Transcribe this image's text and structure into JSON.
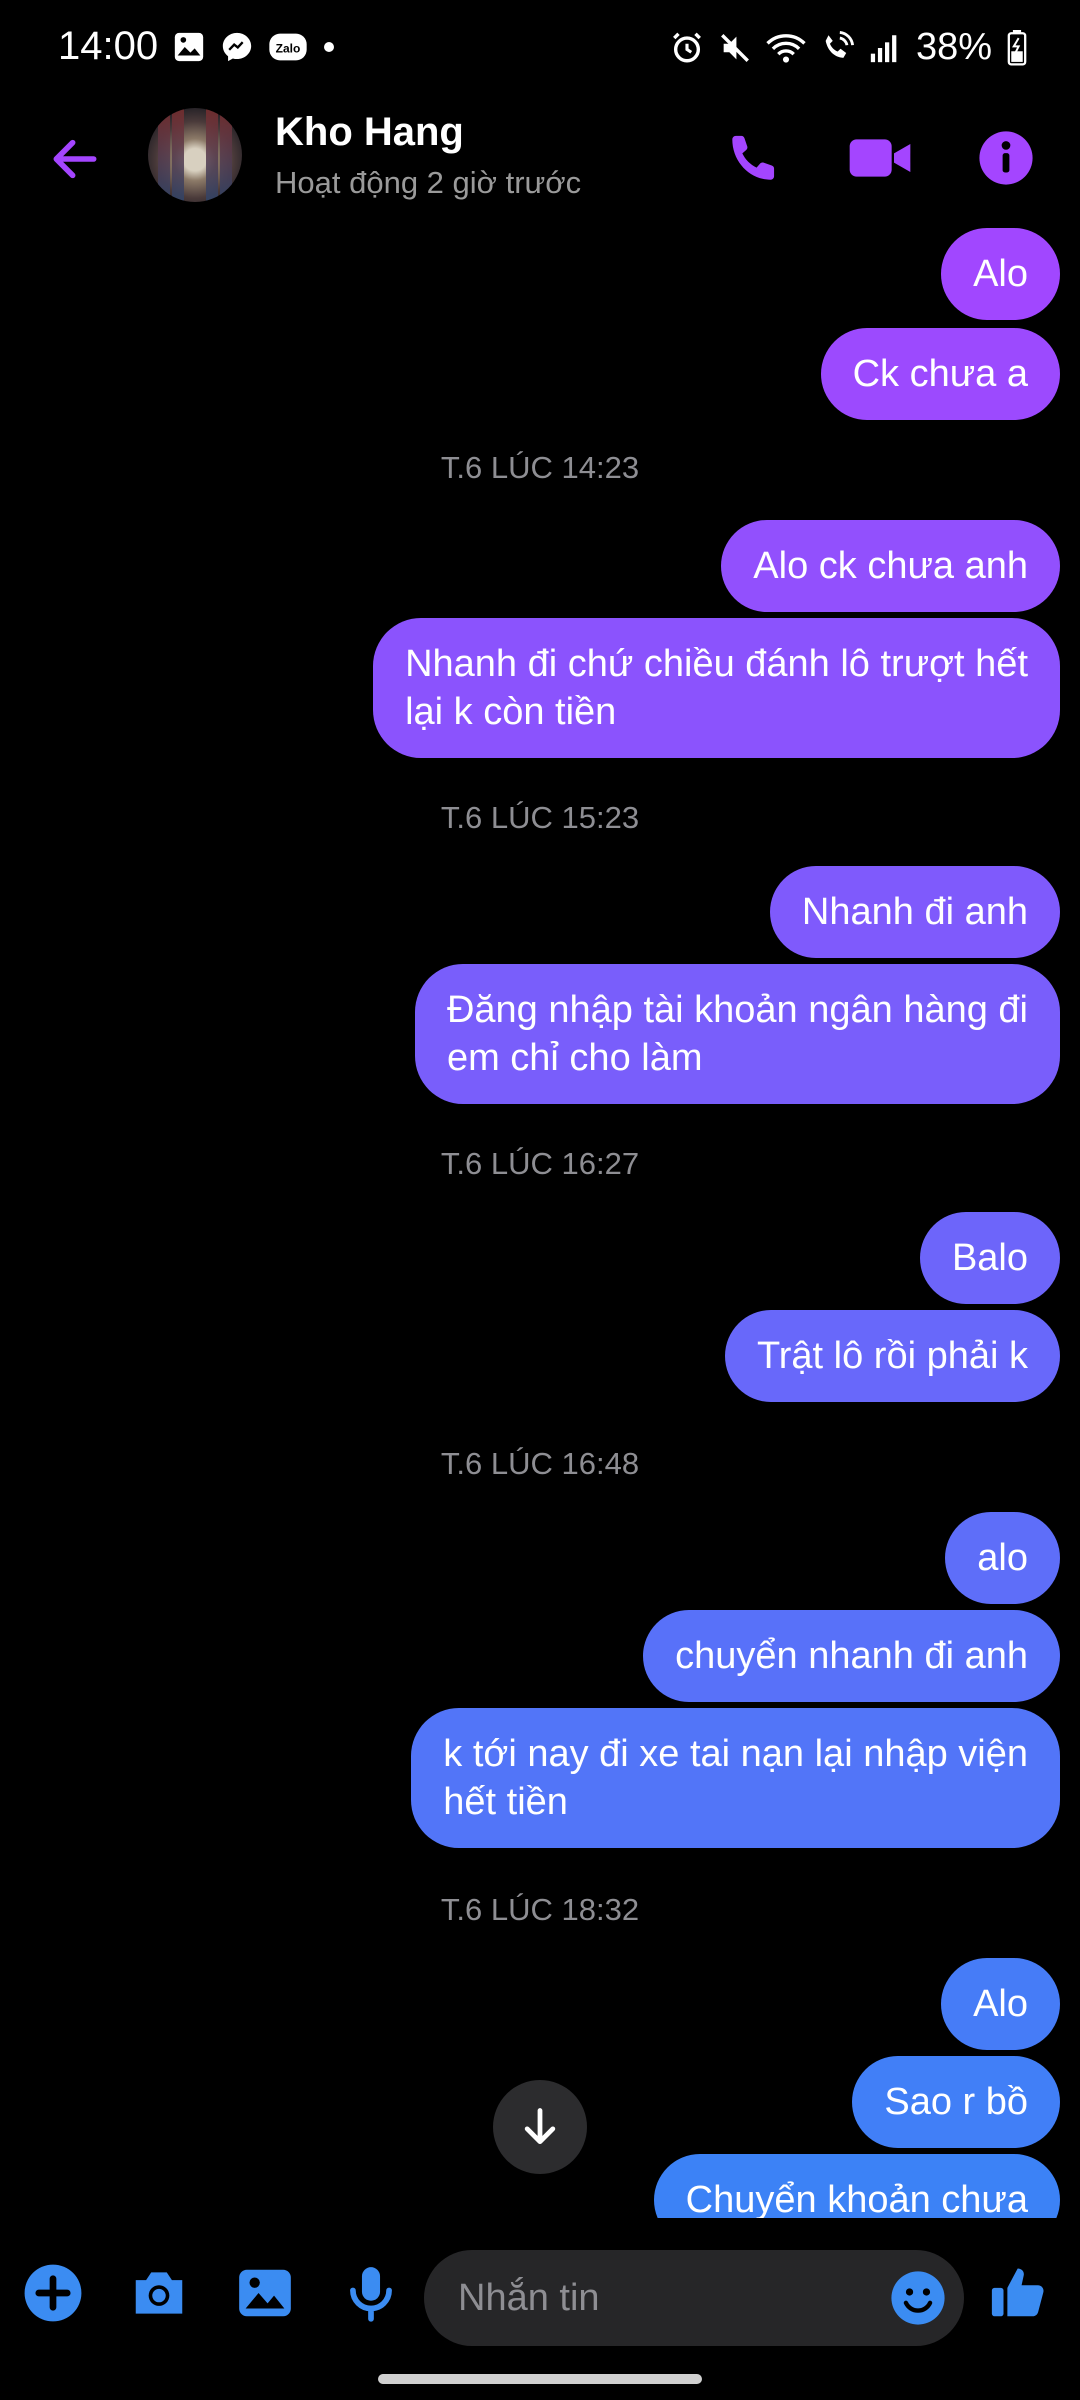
{
  "status_bar": {
    "time": "14:00",
    "battery": "38%",
    "left_icons": [
      "gallery-icon",
      "messenger-icon",
      "zalo-icon",
      "dot-icon"
    ],
    "right_icons": [
      "alarm-icon",
      "mute-icon",
      "wifi-icon",
      "wifi-call-icon",
      "signal-icon",
      "battery-icon"
    ]
  },
  "header": {
    "contact_name": "Kho Hang",
    "contact_status": "Hoạt động 2 giờ trước",
    "accent_color": "#a445ff"
  },
  "messages": [
    {
      "type": "outgoing",
      "text": "Alo"
    },
    {
      "type": "outgoing",
      "text": "Ck chưa a"
    },
    {
      "type": "timestamp",
      "text": "T.6 LÚC 14:23"
    },
    {
      "type": "outgoing",
      "text": "Alo ck chưa anh"
    },
    {
      "type": "outgoing",
      "text": "Nhanh đi chứ chiều đánh lô trượt hết\nlại k còn tiền"
    },
    {
      "type": "timestamp",
      "text": "T.6 LÚC 15:23"
    },
    {
      "type": "outgoing",
      "text": "Nhanh đi anh"
    },
    {
      "type": "outgoing",
      "text": "Đăng nhập tài khoản ngân hàng đi\nem chỉ cho làm"
    },
    {
      "type": "timestamp",
      "text": "T.6 LÚC 16:27"
    },
    {
      "type": "outgoing",
      "text": "Balo"
    },
    {
      "type": "outgoing",
      "text": "Trật lô rồi phải k"
    },
    {
      "type": "timestamp",
      "text": "T.6 LÚC 16:48"
    },
    {
      "type": "outgoing",
      "text": "alo"
    },
    {
      "type": "outgoing",
      "text": "chuyển nhanh đi anh"
    },
    {
      "type": "outgoing",
      "text": "k tới nay đi xe tai nạn lại nhập viện\nhết tiền"
    },
    {
      "type": "timestamp",
      "text": "T.6 LÚC 18:32"
    },
    {
      "type": "outgoing",
      "text": "Alo"
    },
    {
      "type": "outgoing",
      "text": "Sao r bồ"
    },
    {
      "type": "outgoing",
      "text": "Chuyển khoản chưa"
    }
  ],
  "composer": {
    "placeholder": "Nhắn tin",
    "icons": [
      "plus-icon",
      "camera-icon",
      "image-icon",
      "mic-icon",
      "emoji-icon",
      "like-icon"
    ]
  },
  "colors": {
    "bubble_top": "#a445ff",
    "bubble_bottom": "#3b82f6",
    "icon_blue": "#3b8cf2"
  }
}
